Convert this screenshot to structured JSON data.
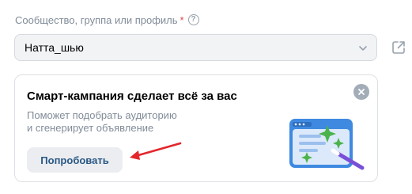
{
  "field": {
    "label": "Сообщество, группа или профиль",
    "required_mark": "*",
    "help_glyph": "?",
    "selected_value": "Натта_шью"
  },
  "icons": {
    "help": "question-circle-icon",
    "chevron": "chevron-down-icon",
    "external": "external-link-icon",
    "close": "close-circle-icon",
    "arrow": "red-arrow-annotation",
    "illustration": "magic-wand-window-illustration"
  },
  "promo": {
    "title": "Смарт-кампания сделает всё за вас",
    "description_line1": "Поможет подобрать аудиторию",
    "description_line2": "и сгенерирует объявление",
    "button_label": "Попробовать"
  },
  "colors": {
    "accent_text": "#2a5885",
    "muted_text": "#818c99",
    "required": "#e64646",
    "annotation": "#e3262b",
    "illustration_blue": "#3f8ae0",
    "sparkle_green": "#4bb34b"
  }
}
